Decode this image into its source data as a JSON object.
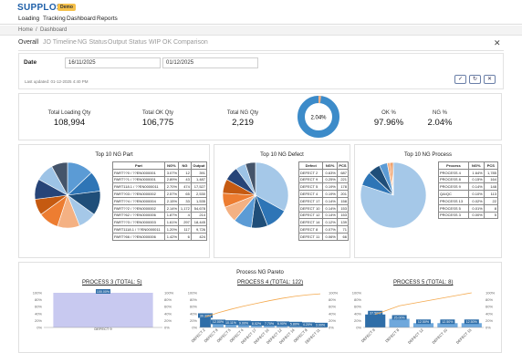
{
  "app": {
    "logo": "SUPPLOS",
    "badge": "Demo"
  },
  "menu": [
    "Loading",
    "Tracking",
    "Dashboard",
    "Reports"
  ],
  "breadcrumb": {
    "home": "Home",
    "sep": "/",
    "current": "Dashboard"
  },
  "tabs": [
    "Overall",
    "JO Timeline",
    "NG Status",
    "Output Status",
    "WIP OK",
    "Comparison"
  ],
  "filters": {
    "date_label": "Date",
    "from": "16/11/2025",
    "to": "01/12/2025",
    "last_updated": "Last updated: 01-12-2025 4:40 PM"
  },
  "kpis": [
    {
      "label": "Total Loading Qty",
      "value": "108,994"
    },
    {
      "label": "Total OK Qty",
      "value": "106,775"
    },
    {
      "label": "Total NG Qty",
      "value": "2,219"
    },
    {
      "label": "OK %",
      "value": "97.96%"
    },
    {
      "label": "NG %",
      "value": "2.04%"
    }
  ],
  "donut": {
    "label": "2.04%",
    "ng_fraction": 0.0204
  },
  "ng_part": {
    "title": "Top 10 NG Part",
    "headers": [
      "Part",
      "NG%",
      "NG",
      "Output"
    ],
    "rows": [
      [
        "PART??0 / ??EN0000001",
        "3.07%",
        "12",
        "391"
      ],
      [
        "PART??1 / ??EN0000001",
        "2.89%",
        "43",
        "1,487"
      ],
      [
        "PART118.1 / ??EN0000011",
        "2.70%",
        "474",
        "17,527"
      ],
      [
        "PART?03 / ??EN0000002",
        "2.57%",
        "65",
        "2,530"
      ],
      [
        "PART??4 / ??EN0000004",
        "2.15%",
        "33",
        "1,535"
      ],
      [
        "PART??2 / ??EN0000002",
        "2.14%",
        "1,172",
        "54,678"
      ],
      [
        "PART?62 / ??EN0000006",
        "1.87%",
        "4",
        "214"
      ],
      [
        "PART??3 / ??EN0000003",
        "1.61%",
        "297",
        "18,445"
      ],
      [
        "PART1118.1 / ??EN0000011",
        "1.20%",
        "117",
        "9,726"
      ],
      [
        "PART?66 / ??EN0000006",
        "1.42%",
        "6",
        "424"
      ]
    ],
    "pie": [
      0.13,
      0.1,
      0.12,
      0.09,
      0.11,
      0.1,
      0.08,
      0.1,
      0.09,
      0.08
    ],
    "colors": [
      "#5b9bd5",
      "#2e75b6",
      "#1f4e79",
      "#a5c8e8",
      "#f4b183",
      "#ed7d31",
      "#c55a11",
      "#264478",
      "#9dc3e6",
      "#44546a"
    ]
  },
  "ng_defect": {
    "title": "Top 10 NG Defect",
    "headers": [
      "Defect",
      "NG%",
      "PCS"
    ],
    "rows": [
      [
        "DEFECT 2",
        "0.63%",
        "687"
      ],
      [
        "DEFECT 9",
        "0.25%",
        "221"
      ],
      [
        "DEFECT 5",
        "0.19%",
        "178"
      ],
      [
        "DEFECT 4",
        "0.19%",
        "201"
      ],
      [
        "DEFECT 17",
        "0.14%",
        "158"
      ],
      [
        "DEFECT 10",
        "0.14%",
        "153"
      ],
      [
        "DEFECT 12",
        "0.14%",
        "153"
      ],
      [
        "DEFECT 14",
        "0.12%",
        "139"
      ],
      [
        "DEFECT 8",
        "0.07%",
        "71"
      ],
      [
        "DEFECT 11",
        "0.06%",
        "66"
      ]
    ],
    "pie": [
      0.33,
      0.11,
      0.08,
      0.09,
      0.08,
      0.07,
      0.07,
      0.07,
      0.05,
      0.05
    ],
    "colors": [
      "#a5c8e8",
      "#2e75b6",
      "#1f4e79",
      "#5b9bd5",
      "#f4b183",
      "#ed7d31",
      "#c55a11",
      "#264478",
      "#9dc3e6",
      "#44546a"
    ]
  },
  "ng_process": {
    "title": "Top 10 NG Process",
    "headers": [
      "Process",
      "NG%",
      "PCS"
    ],
    "rows": [
      [
        "PROCESS 4",
        "1.64%",
        "1,785"
      ],
      [
        "PROCESS 8",
        "0.15%",
        "164"
      ],
      [
        "PROCESS 9",
        "0.14%",
        "148"
      ],
      [
        "QA/QC",
        "0.10%",
        "113"
      ],
      [
        "PROCESS 13",
        "0.02%",
        "22"
      ],
      [
        "PROCESS 5",
        "0.01%",
        "8"
      ],
      [
        "PROCESS 3",
        "0.00%",
        "5"
      ]
    ],
    "pie": [
      0.8,
      0.07,
      0.06,
      0.04,
      0.015,
      0.01,
      0.005
    ],
    "colors": [
      "#a5c8e8",
      "#2e75b6",
      "#1f4e79",
      "#5b9bd5",
      "#f4b183",
      "#ed7d31",
      "#c55a11"
    ]
  },
  "pareto": {
    "title": "Process NG Pareto",
    "charts": [
      {
        "title": "PROCESS 3 (TOTAL: 5)",
        "bars": [
          {
            "cat": "DEFECT 9",
            "pct": 100,
            "label": "100.00%"
          }
        ]
      },
      {
        "title": "PROCESS 4 (TOTAL: 122)",
        "bars": [
          {
            "cat": "DEFECT 2",
            "pct": 30.33,
            "label": "30.33%"
          },
          {
            "cat": "DEFECT 9",
            "pct": 12,
            "label": "12.00%"
          },
          {
            "cat": "DEFECT 5",
            "pct": 10.11,
            "label": "10.11%"
          },
          {
            "cat": "DEFECT 4",
            "pct": 9,
            "label": "9.00%"
          },
          {
            "cat": "DEFECT 17",
            "pct": 8.02,
            "label": "8.02%"
          },
          {
            "cat": "DEFECT 10",
            "pct": 7.7,
            "label": "7.70%"
          },
          {
            "cat": "DEFECT 12",
            "pct": 6.9,
            "label": "6.90%"
          },
          {
            "cat": "DEFECT 14",
            "pct": 5.8,
            "label": "5.80%"
          },
          {
            "cat": "DEFECT 8",
            "pct": 4.2,
            "label": "4.20%"
          },
          {
            "cat": "DEFECT 11",
            "pct": 3,
            "label": "3.00%"
          }
        ]
      },
      {
        "title": "PROCESS 5 (TOTAL: 8)",
        "bars": [
          {
            "cat": "DEFECT 9",
            "pct": 37.5,
            "label": "37.50%"
          },
          {
            "cat": "DEFECT 8",
            "pct": 25,
            "label": "25.00%"
          },
          {
            "cat": "DEFECT 12",
            "pct": 12.5,
            "label": "12.50%"
          },
          {
            "cat": "DEFECT 10",
            "pct": 12.5,
            "label": "12.50%"
          },
          {
            "cat": "DEFECT 15",
            "pct": 12.5,
            "label": "12.50%"
          }
        ]
      }
    ]
  }
}
